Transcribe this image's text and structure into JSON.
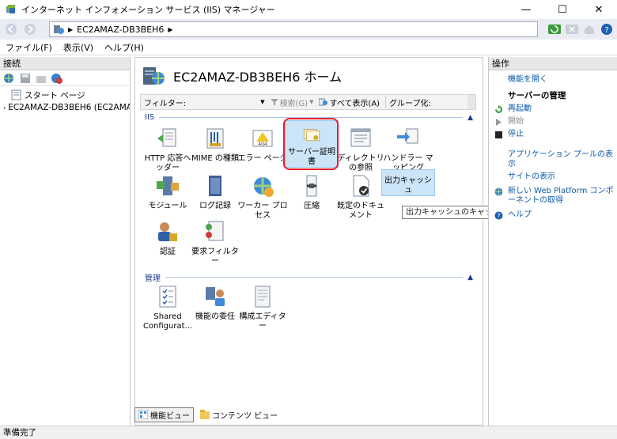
{
  "window": {
    "title": "インターネット インフォメーション サービス (IIS) マネージャー",
    "minimize": "—",
    "maximize": "☐",
    "close": "✕"
  },
  "address": {
    "crumb": "EC2AMAZ-DB3BEH6",
    "sep1": "▶",
    "sep2": "▶"
  },
  "menu": {
    "file": "ファイル(F)",
    "view": "表示(V)",
    "help": "ヘルプ(H)"
  },
  "connections": {
    "header": "接続",
    "tree": [
      {
        "label": "スタート ページ"
      },
      {
        "label": "EC2AMAZ-DB3BEH6 (EC2AMA"
      }
    ]
  },
  "main": {
    "title": "EC2AMAZ-DB3BEH6 ホーム",
    "filter_label": "フィルター:",
    "search_label": "検索(G)",
    "show_all_label": "すべて表示(A)",
    "group_label": "グループ化:",
    "groups": {
      "iis": "IIS",
      "management": "管理"
    },
    "features_iis_row1": [
      {
        "label": "HTTP 応答ヘッダー"
      },
      {
        "label": "MIME の種類"
      },
      {
        "label": "エラー ページ"
      },
      {
        "label": "サーバー証明書"
      },
      {
        "label": "ディレクトリの参照"
      },
      {
        "label": "ハンドラー マッピング"
      }
    ],
    "features_iis_row2": [
      {
        "label": "モジュール"
      },
      {
        "label": "ログ記録"
      },
      {
        "label": "ワーカー プロセス"
      },
      {
        "label": "圧縮"
      },
      {
        "label": "既定のドキュメント"
      },
      {
        "label": "出力キャッシュ"
      }
    ],
    "features_iis_row3": [
      {
        "label": "認証"
      },
      {
        "label": "要求フィルター"
      }
    ],
    "features_mgmt": [
      {
        "label": "Shared Configurat..."
      },
      {
        "label": "機能の委任"
      },
      {
        "label": "構成エディター"
      }
    ],
    "tooltip": "出力キャッシュのキャッシュ供給コンテンツの規則を指定します",
    "view_tabs": {
      "features": "機能ビュー",
      "content": "コンテンツ ビュー"
    }
  },
  "actions": {
    "header": "操作",
    "open_feature": "機能を開く",
    "server_mgmt": "サーバーの管理",
    "restart": "再起動",
    "start": "開始",
    "stop": "停止",
    "app_pools": "アプリケーション プールの表示",
    "sites": "サイトの表示",
    "web_platform": "新しい Web Platform コンポーネントの取得",
    "help": "ヘルプ"
  },
  "status": {
    "text": "準備完了"
  },
  "colors": {
    "accent": "#0a58a8",
    "highlight": "#e8202a",
    "selected_bg": "#cce4f7"
  }
}
